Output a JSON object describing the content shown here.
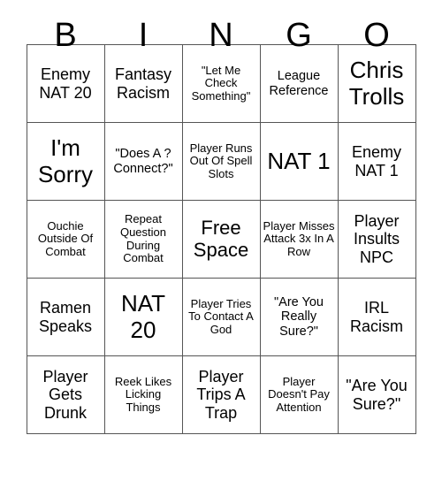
{
  "header": {
    "letters": [
      "B",
      "I",
      "N",
      "G",
      "O"
    ]
  },
  "grid": {
    "rows": [
      [
        {
          "text": "Enemy NAT 20",
          "size": "sz-md"
        },
        {
          "text": "Fantasy Racism",
          "size": "sz-md"
        },
        {
          "text": "\"Let Me Check Something\"",
          "size": "sz-xs"
        },
        {
          "text": "League Reference",
          "size": "sz-sm"
        },
        {
          "text": "Chris Trolls",
          "size": "sz-xl"
        }
      ],
      [
        {
          "text": "I'm Sorry",
          "size": "sz-xl"
        },
        {
          "text": "\"Does A ? Connect?\"",
          "size": "sz-sm"
        },
        {
          "text": "Player Runs Out Of Spell Slots",
          "size": "sz-xs"
        },
        {
          "text": "NAT 1",
          "size": "sz-xl"
        },
        {
          "text": "Enemy NAT 1",
          "size": "sz-md"
        }
      ],
      [
        {
          "text": "Ouchie Outside Of Combat",
          "size": "sz-xs"
        },
        {
          "text": "Repeat Question During Combat",
          "size": "sz-xs"
        },
        {
          "text": "Free Space",
          "size": "sz-lg"
        },
        {
          "text": "Player Misses Attack 3x In A Row",
          "size": "sz-xs"
        },
        {
          "text": "Player Insults NPC",
          "size": "sz-md"
        }
      ],
      [
        {
          "text": "Ramen Speaks",
          "size": "sz-md"
        },
        {
          "text": "NAT 20",
          "size": "sz-xl"
        },
        {
          "text": "Player Tries To Contact A God",
          "size": "sz-xs"
        },
        {
          "text": "\"Are You Really Sure?\"",
          "size": "sz-sm"
        },
        {
          "text": "IRL Racism",
          "size": "sz-md"
        }
      ],
      [
        {
          "text": "Player Gets Drunk",
          "size": "sz-md"
        },
        {
          "text": "Reek Likes Licking Things",
          "size": "sz-xs"
        },
        {
          "text": "Player Trips A Trap",
          "size": "sz-md"
        },
        {
          "text": "Player Doesn't Pay Attention",
          "size": "sz-xs"
        },
        {
          "text": "\"Are You Sure?\"",
          "size": "sz-md"
        }
      ]
    ]
  },
  "colors": {
    "background": "#ffffff",
    "text": "#000000",
    "border": "#555555"
  }
}
